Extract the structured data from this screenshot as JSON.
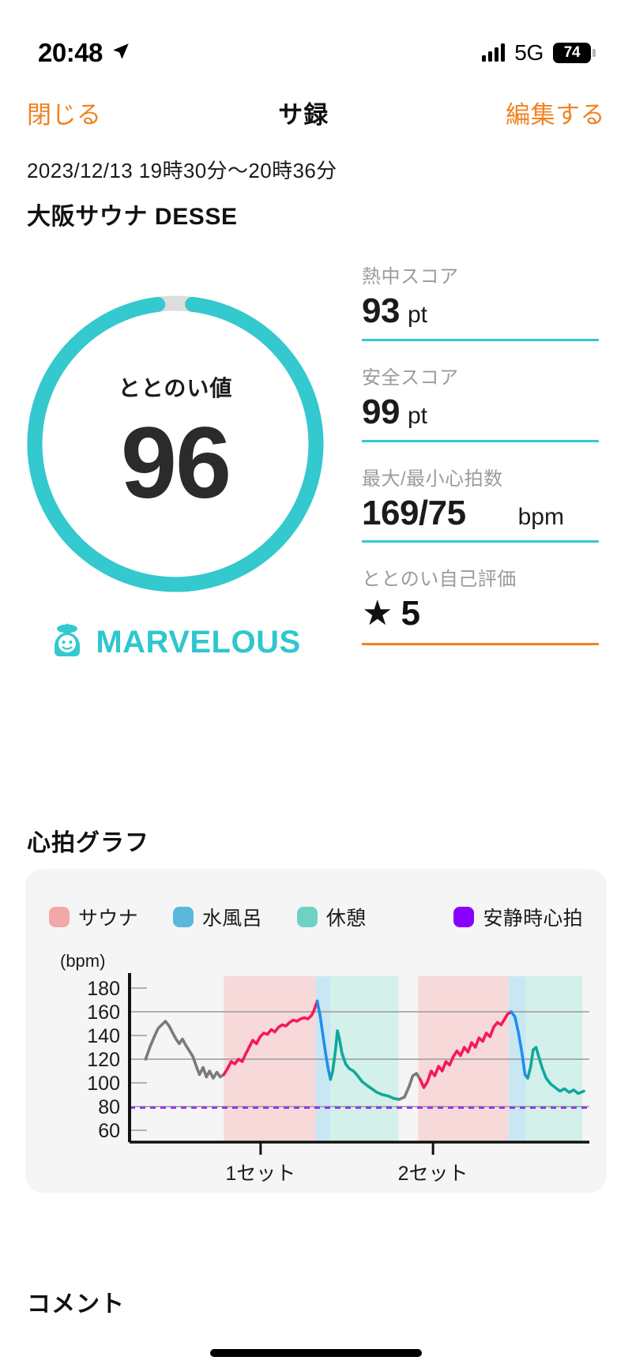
{
  "status_bar": {
    "time": "20:48",
    "location_icon": "location-arrow-icon",
    "network": "5G",
    "battery_level": "74"
  },
  "nav": {
    "close_label": "閉じる",
    "title": "サ録",
    "edit_label": "編集する"
  },
  "header": {
    "date_range": "2023/12/13 19時30分〜20時36分",
    "place": "大阪サウナ DESSE"
  },
  "score": {
    "ring_label": "ととのい値",
    "ring_value": "96",
    "ring_max": 100,
    "ring_color": "#34c8cf",
    "ring_track_color": "#dddddd",
    "badge_icon": "sauna-character-icon",
    "badge_text": "MARVELOUS",
    "badge_color": "#2fc7ce"
  },
  "stats": [
    {
      "label": "熱中スコア",
      "value": "93",
      "unit": "pt",
      "underline_color": "#34c8cf"
    },
    {
      "label": "安全スコア",
      "value": "99",
      "unit": "pt",
      "underline_color": "#34c8cf"
    },
    {
      "label": "最大/最小心拍数",
      "value": "169/75",
      "unit": "bpm",
      "underline_color": "#34c8cf"
    },
    {
      "label": "ととのい自己評価",
      "value": "5",
      "star": "★",
      "unit": "",
      "underline_color": "#f08221"
    }
  ],
  "chart_section": {
    "title": "心拍グラフ",
    "unit_label": "(bpm)"
  },
  "comment": {
    "title": "コメント"
  },
  "chart_data": {
    "type": "line",
    "title": "心拍グラフ",
    "ylabel": "(bpm)",
    "xlabel": "",
    "ylim": [
      50,
      190
    ],
    "yticks": [
      180,
      160,
      140,
      120,
      100,
      80,
      60
    ],
    "gridlines": [
      160,
      120,
      80
    ],
    "grid": true,
    "legend_position": "top",
    "legend": [
      {
        "name": "サウナ",
        "color": "#f2a8a8"
      },
      {
        "name": "水風呂",
        "color": "#5bb8dd"
      },
      {
        "name": "休憩",
        "color": "#6fd1c4"
      },
      {
        "name": "安静時心拍",
        "color": "#8a00ff"
      }
    ],
    "resting_hr": 79,
    "xticks": [
      {
        "label": "1セット",
        "x": 0.285
      },
      {
        "label": "2セット",
        "x": 0.66
      }
    ],
    "bands": [
      {
        "phase": "サウナ",
        "x0": 0.205,
        "x1": 0.405,
        "color": "#f7d4d4"
      },
      {
        "phase": "水風呂",
        "x0": 0.405,
        "x1": 0.437,
        "color": "#bfe4f2"
      },
      {
        "phase": "休憩",
        "x0": 0.437,
        "x1": 0.585,
        "color": "#cdeee7"
      },
      {
        "phase": "サウナ",
        "x0": 0.628,
        "x1": 0.825,
        "color": "#f7d4d4"
      },
      {
        "phase": "水風呂",
        "x0": 0.825,
        "x1": 0.862,
        "color": "#bfe4f2"
      },
      {
        "phase": "休憩",
        "x0": 0.862,
        "x1": 0.985,
        "color": "#cdeee7"
      }
    ],
    "series": [
      {
        "name": "心拍数",
        "unit": "bpm",
        "segment_colors": {
          "idle": "#7b7b7b",
          "サウナ": "#f5185f",
          "水風呂": "#1f8ef1",
          "休憩": "#0fa89b"
        },
        "points": [
          [
            0.035,
            120
          ],
          [
            0.045,
            131
          ],
          [
            0.055,
            140
          ],
          [
            0.062,
            146
          ],
          [
            0.07,
            149
          ],
          [
            0.078,
            152
          ],
          [
            0.086,
            148
          ],
          [
            0.094,
            142
          ],
          [
            0.101,
            137
          ],
          [
            0.108,
            133
          ],
          [
            0.115,
            137
          ],
          [
            0.122,
            132
          ],
          [
            0.13,
            127
          ],
          [
            0.138,
            122
          ],
          [
            0.146,
            113
          ],
          [
            0.152,
            107
          ],
          [
            0.16,
            113
          ],
          [
            0.167,
            105
          ],
          [
            0.174,
            110
          ],
          [
            0.182,
            104
          ],
          [
            0.19,
            109
          ],
          [
            0.197,
            105
          ],
          [
            0.205,
            107
          ],
          [
            0.213,
            112
          ],
          [
            0.221,
            118
          ],
          [
            0.229,
            116
          ],
          [
            0.237,
            120
          ],
          [
            0.245,
            118
          ],
          [
            0.252,
            124
          ],
          [
            0.26,
            130
          ],
          [
            0.268,
            136
          ],
          [
            0.276,
            133
          ],
          [
            0.284,
            139
          ],
          [
            0.292,
            142
          ],
          [
            0.3,
            141
          ],
          [
            0.308,
            145
          ],
          [
            0.316,
            143
          ],
          [
            0.324,
            147
          ],
          [
            0.332,
            149
          ],
          [
            0.34,
            148
          ],
          [
            0.348,
            151
          ],
          [
            0.356,
            153
          ],
          [
            0.364,
            152
          ],
          [
            0.372,
            154
          ],
          [
            0.38,
            155
          ],
          [
            0.388,
            154
          ],
          [
            0.396,
            157
          ],
          [
            0.402,
            162
          ],
          [
            0.408,
            169
          ],
          [
            0.414,
            158
          ],
          [
            0.42,
            142
          ],
          [
            0.426,
            126
          ],
          [
            0.432,
            112
          ],
          [
            0.437,
            103
          ],
          [
            0.442,
            110
          ],
          [
            0.448,
            128
          ],
          [
            0.452,
            144
          ],
          [
            0.456,
            138
          ],
          [
            0.462,
            125
          ],
          [
            0.47,
            116
          ],
          [
            0.478,
            112
          ],
          [
            0.487,
            110
          ],
          [
            0.496,
            106
          ],
          [
            0.506,
            101
          ],
          [
            0.516,
            98
          ],
          [
            0.527,
            95
          ],
          [
            0.538,
            92
          ],
          [
            0.55,
            90
          ],
          [
            0.562,
            89
          ],
          [
            0.574,
            87
          ],
          [
            0.586,
            86
          ],
          [
            0.598,
            88
          ],
          [
            0.608,
            97
          ],
          [
            0.616,
            106
          ],
          [
            0.624,
            108
          ],
          [
            0.632,
            103
          ],
          [
            0.64,
            96
          ],
          [
            0.648,
            101
          ],
          [
            0.656,
            110
          ],
          [
            0.664,
            106
          ],
          [
            0.672,
            114
          ],
          [
            0.68,
            110
          ],
          [
            0.688,
            118
          ],
          [
            0.696,
            115
          ],
          [
            0.704,
            122
          ],
          [
            0.712,
            127
          ],
          [
            0.72,
            123
          ],
          [
            0.728,
            130
          ],
          [
            0.736,
            126
          ],
          [
            0.744,
            134
          ],
          [
            0.752,
            130
          ],
          [
            0.76,
            138
          ],
          [
            0.768,
            135
          ],
          [
            0.776,
            142
          ],
          [
            0.784,
            139
          ],
          [
            0.792,
            147
          ],
          [
            0.8,
            151
          ],
          [
            0.808,
            149
          ],
          [
            0.816,
            154
          ],
          [
            0.822,
            158
          ],
          [
            0.83,
            160
          ],
          [
            0.838,
            156
          ],
          [
            0.846,
            142
          ],
          [
            0.854,
            124
          ],
          [
            0.86,
            107
          ],
          [
            0.866,
            104
          ],
          [
            0.872,
            113
          ],
          [
            0.878,
            128
          ],
          [
            0.884,
            130
          ],
          [
            0.89,
            122
          ],
          [
            0.898,
            112
          ],
          [
            0.906,
            104
          ],
          [
            0.916,
            99
          ],
          [
            0.926,
            96
          ],
          [
            0.936,
            93
          ],
          [
            0.946,
            95
          ],
          [
            0.956,
            92
          ],
          [
            0.966,
            94
          ],
          [
            0.976,
            91
          ],
          [
            0.988,
            93
          ]
        ]
      }
    ]
  }
}
